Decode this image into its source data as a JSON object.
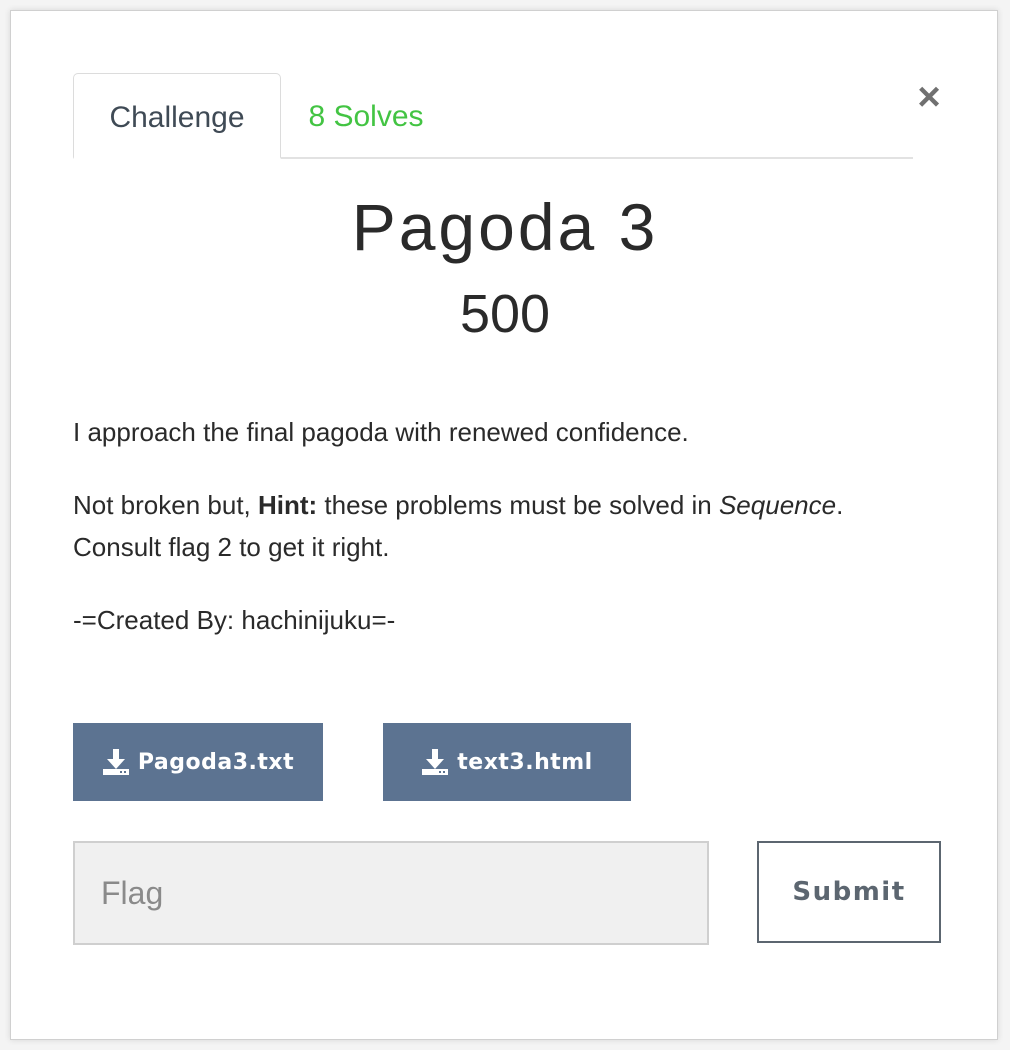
{
  "tabs": {
    "challenge_label": "Challenge",
    "solves_label": "8 Solves"
  },
  "close_glyph": "×",
  "challenge": {
    "name": "Pagoda 3",
    "points": "500",
    "description": {
      "para1": "I approach the final pagoda with renewed confidence.",
      "para2_prefix": "Not broken but, ",
      "para2_bold": "Hint:",
      "para2_mid": " these problems must be solved in ",
      "para2_italic": "Sequence",
      "para2_suffix": ".",
      "para2_line2": "Consult flag 2 to get it right.",
      "para3": "-=Created By: hachinijuku=-"
    }
  },
  "files": [
    {
      "label": "Pagoda3.txt",
      "icon": "download-icon"
    },
    {
      "label": "text3.html",
      "icon": "download-icon"
    }
  ],
  "flag_form": {
    "placeholder": "Flag",
    "submit_label": "Submit"
  },
  "colors": {
    "solves_green": "#43c443",
    "button_blue": "#5c7391",
    "submit_border": "#5c6670"
  }
}
